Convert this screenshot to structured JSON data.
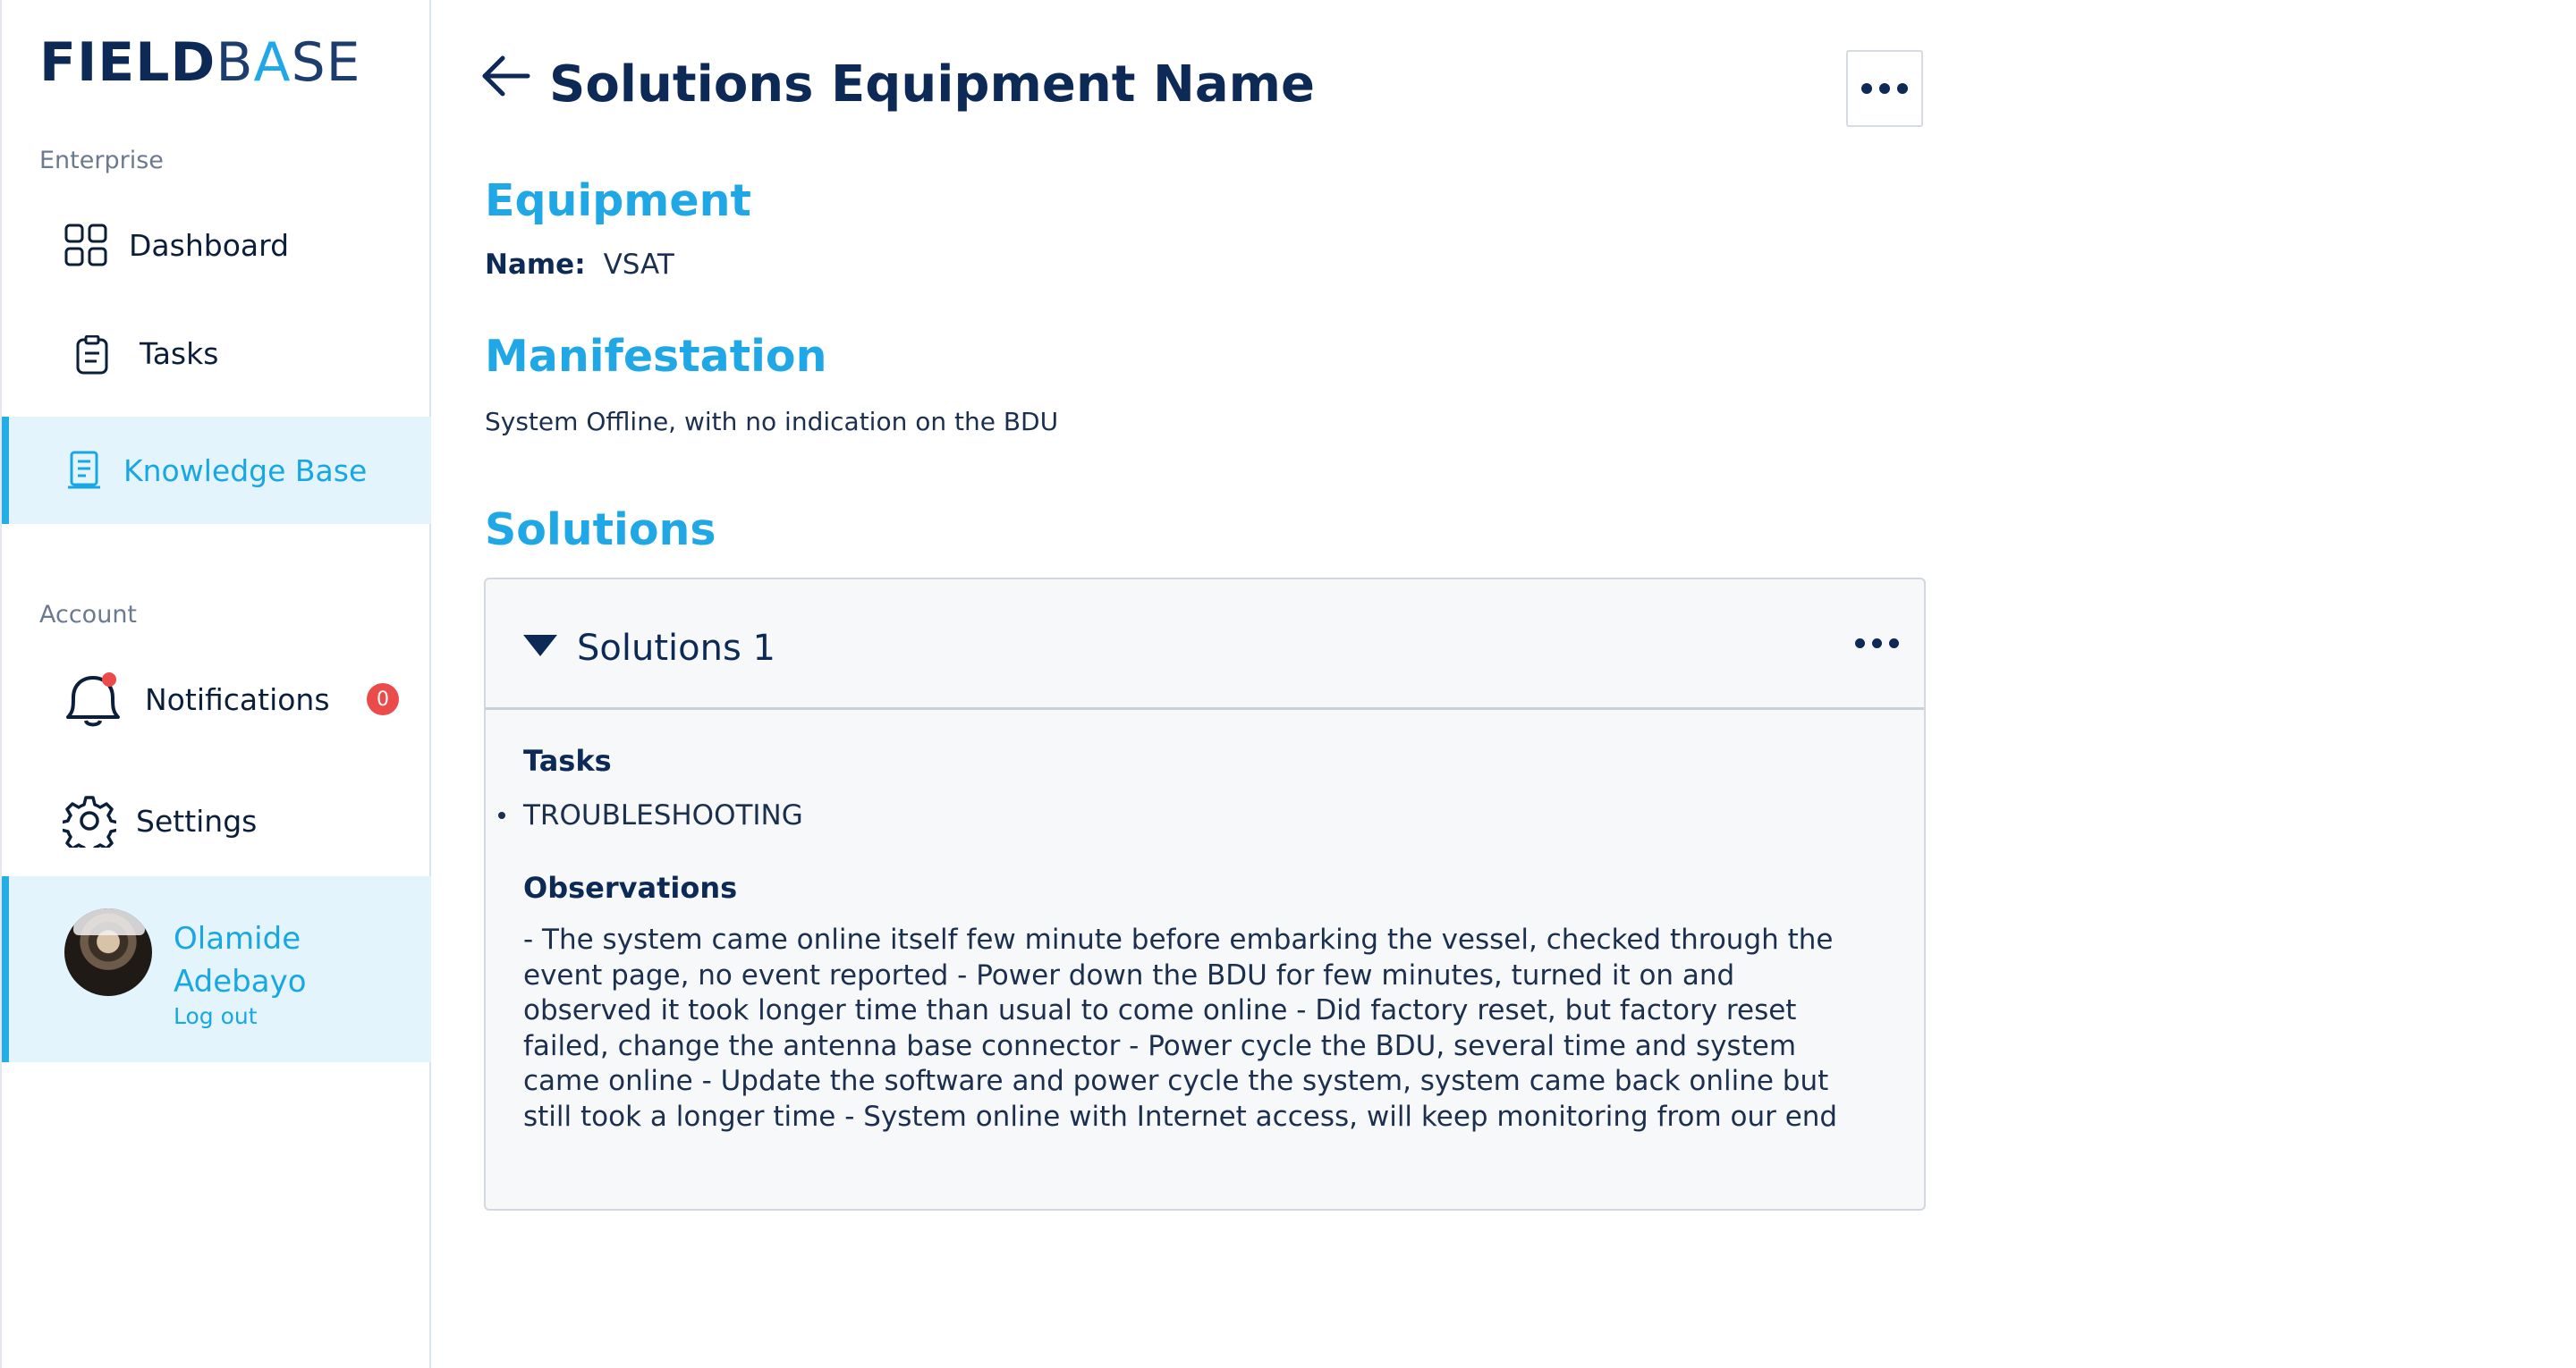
{
  "brand": {
    "part1": "FIELD",
    "part2": "B",
    "part3": "A",
    "part4": "SE"
  },
  "sidebar": {
    "enterprise_label": "Enterprise",
    "account_label": "Account",
    "items": [
      {
        "label": "Dashboard",
        "icon": "grid-icon"
      },
      {
        "label": "Tasks",
        "icon": "clipboard-icon"
      },
      {
        "label": "Knowledge Base",
        "icon": "document-icon",
        "active": true
      }
    ],
    "account_items": [
      {
        "label": "Notifications",
        "icon": "bell-icon",
        "badge": "0"
      },
      {
        "label": "Settings",
        "icon": "gear-icon"
      }
    ],
    "user": {
      "name": "Olamide Adebayo",
      "logout": "Log out"
    }
  },
  "header": {
    "title": "Solutions Equipment Name"
  },
  "equipment": {
    "heading": "Equipment",
    "name_key": "Name:",
    "name_value": "VSAT"
  },
  "manifestation": {
    "heading": "Manifestation",
    "text": "System Offline, with no indication on the BDU"
  },
  "solutions": {
    "heading": "Solutions",
    "card": {
      "title": "Solutions 1",
      "tasks_heading": "Tasks",
      "tasks": [
        "TROUBLESHOOTING"
      ],
      "observations_heading": "Observations",
      "observations": "- The system came online itself few minute before embarking the vessel, checked through the event page, no event reported - Power down the BDU for few minutes, turned it on and observed it took longer time than usual to come online - Did factory reset, but factory reset failed, change the antenna base connector - Power cycle the BDU, several time and system came online - Update the software and power cycle the system, system came back online but still took a longer time - System online with Internet access, will keep monitoring from our end"
    }
  },
  "colors": {
    "accent": "#1fa7e6",
    "navy": "#0d2a57",
    "badge": "#ec4b4b",
    "active_bg": "#e3f4fc"
  }
}
